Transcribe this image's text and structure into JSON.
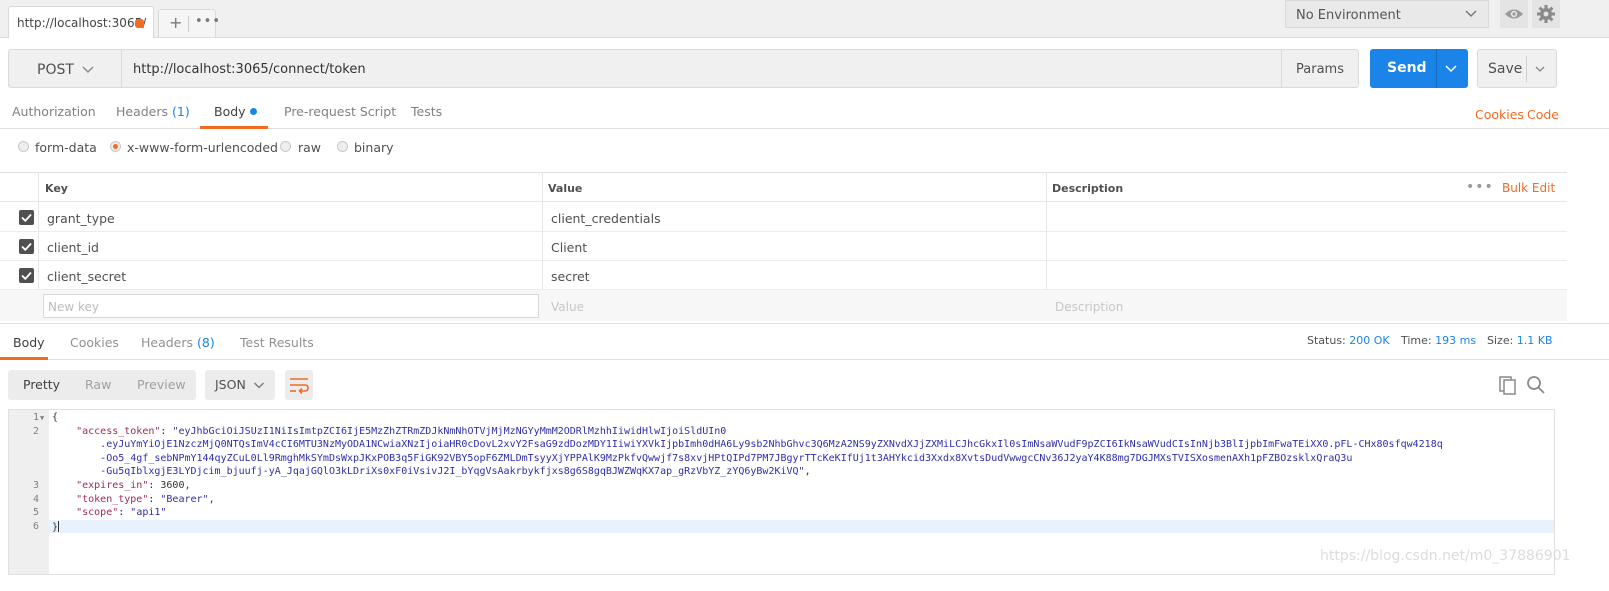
{
  "tabs": {
    "active_title": "http://localhost:3065/",
    "new_tab": "+",
    "more": "•••"
  },
  "environment": {
    "selected": "No Environment"
  },
  "request": {
    "method": "POST",
    "url": "http://localhost:3065/connect/token",
    "params_label": "Params",
    "send_label": "Send",
    "save_label": "Save"
  },
  "request_tabs": [
    {
      "label": "Authorization"
    },
    {
      "label": "Headers",
      "count": "(1)"
    },
    {
      "label": "Body"
    },
    {
      "label": "Pre-request Script"
    },
    {
      "label": "Tests"
    }
  ],
  "request_links": {
    "cookies": "Cookies",
    "code": "Code"
  },
  "body_types": [
    {
      "label": "form-data",
      "selected": false
    },
    {
      "label": "x-www-form-urlencoded",
      "selected": true
    },
    {
      "label": "raw",
      "selected": false
    },
    {
      "label": "binary",
      "selected": false
    }
  ],
  "kv_table": {
    "headers": {
      "key": "Key",
      "value": "Value",
      "description": "Description"
    },
    "rows": [
      {
        "key": "grant_type",
        "value": "client_credentials",
        "checked": true
      },
      {
        "key": "client_id",
        "value": "Client",
        "checked": true
      },
      {
        "key": "client_secret",
        "value": "secret",
        "checked": true
      }
    ],
    "placeholders": {
      "key": "New key",
      "value": "Value",
      "description": "Description"
    },
    "more": "•••",
    "bulk_edit": "Bulk Edit"
  },
  "response_tabs": [
    {
      "label": "Body"
    },
    {
      "label": "Cookies"
    },
    {
      "label": "Headers",
      "count": "(8)"
    },
    {
      "label": "Test Results"
    }
  ],
  "response_meta": {
    "status_label": "Status:",
    "status": "200 OK",
    "time_label": "Time:",
    "time": "193 ms",
    "size_label": "Size:",
    "size": "1.1 KB"
  },
  "view_modes": [
    "Pretty",
    "Raw",
    "Preview"
  ],
  "format": "JSON",
  "code": {
    "line_numbers": [
      "1",
      "2",
      "3",
      "4",
      "5",
      "6"
    ],
    "open_brace": "{",
    "close_brace": "}",
    "access_token_key": "\"access_token\"",
    "token_lines": [
      "\"eyJhbGciOiJSUzI1NiIsImtpZCI6IjE5MzZhZTRmZDJkNmNhOTVjMjMzNGYyMmM2ODRlMzhhIiwidHlwIjoiSldUIn0",
      ".eyJuYmYiOjE1NzczMjQ0NTQsImV4cCI6MTU3NzMyODA1NCwiaXNzIjoiaHR0cDovL2xvY2FsaG9zdDozMDY1IiwiYXVkIjpbImh0dHA6Ly9sb2NhbGhvc3Q6MzA2NS9yZXNvdXJjZXMiLCJhcGkxIl0sImNsaWVudF9pZCI6IkNsaWVudCIsInNjb3BlIjpbImFwaTEiXX0.pFL-CHx80sfqw4218q",
      "-Oo5_4gf_sebNPmY144qyZCuL0Ll9RmghMkSYmDsWxpJKxPOB3q5FiGK92VBY5opF6ZMLDmTsyyXjYPPAlK9MzPkfvQwwjf7s8xvjHPtQIPd7PM7JBgyrTTcKeKIfUj1t3AHYkcid3Xxdx8XvtsDudVwwgcCNv36J2yaY4K88mg7DGJMXsTVISXosmenAXh1pFZBOzsklxQraQ3u",
      "-Gu5qIblxgjE3LYDjcim_bjuufj-yA_JqajGQlO3kLDriXs0xF0iVsivJ2I_bYqgVsAakrbykfjxs8g6S8gqBJWZWqKX7ap_gRzVbYZ_zYQ6yBw2KiVQ\""
    ],
    "expires_key": "\"expires_in\"",
    "expires_val": "3600",
    "token_type_key": "\"token_type\"",
    "token_type_val": "\"Bearer\"",
    "scope_key": "\"scope\"",
    "scope_val": "\"api1\""
  },
  "watermark": "https://blog.csdn.net/m0_37886901",
  "colors": {
    "accent": "#f26b21",
    "send": "#1a84e8",
    "link_blue": "#1a84e8"
  }
}
